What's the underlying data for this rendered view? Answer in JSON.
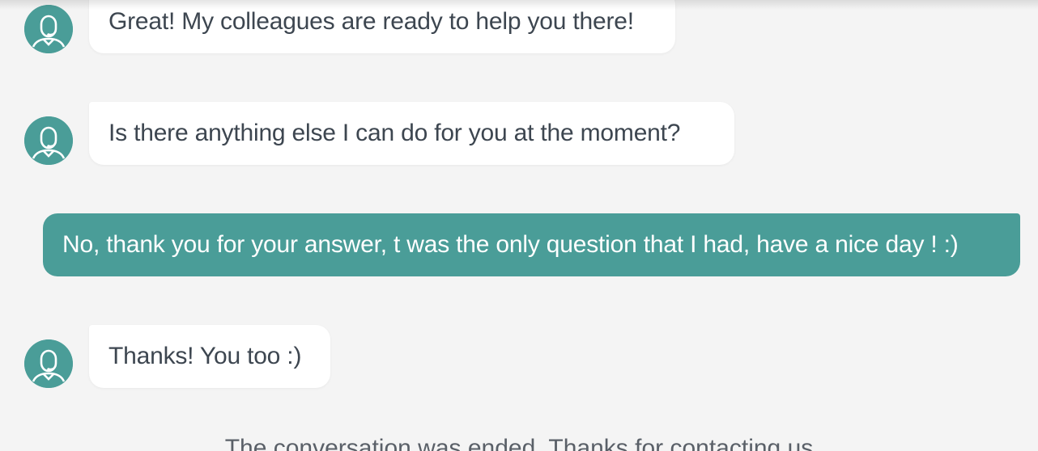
{
  "colors": {
    "accent": "#4a9d98",
    "background": "#f4f4f4",
    "bot_bubble": "#ffffff",
    "bot_text": "#3d4650",
    "user_text": "#ffffff"
  },
  "messages": [
    {
      "sender": "bot",
      "avatar_icon": "support-agent-icon",
      "text": "Great! My colleagues are ready to help you there!"
    },
    {
      "sender": "bot",
      "avatar_icon": "support-agent-icon",
      "text": "Is there anything else I can do for you at the moment?"
    },
    {
      "sender": "user",
      "text": "No, thank you for your answer, t was the only question that I had, have a nice day ! :)"
    },
    {
      "sender": "bot",
      "avatar_icon": "support-agent-icon",
      "text": "Thanks! You too :)"
    }
  ],
  "footer": {
    "notice": "The conversation was ended. Thanks for contacting us"
  }
}
